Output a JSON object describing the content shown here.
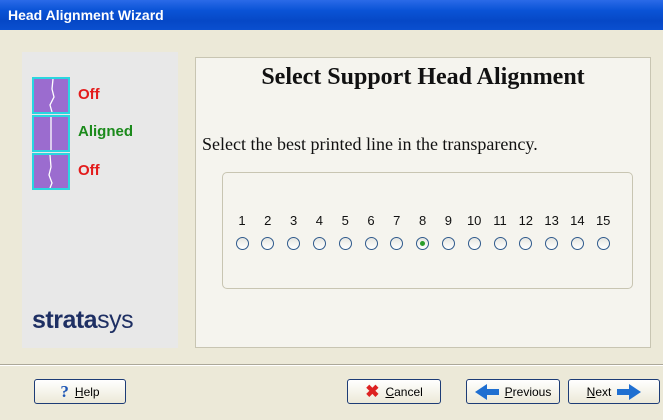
{
  "window": {
    "title": "Head Alignment Wizard"
  },
  "indicators": [
    {
      "label": "Off",
      "color": "#e31b1b",
      "status": "off"
    },
    {
      "label": "Aligned",
      "color": "#1b8a1b",
      "status": "aligned"
    },
    {
      "label": "Off",
      "color": "#e31b1b",
      "status": "off"
    }
  ],
  "logo": {
    "bold": "strata",
    "regular": "sys"
  },
  "main": {
    "heading": "Select Support Head Alignment",
    "instruction": "Select the best printed line in the transparency.",
    "options": [
      "1",
      "2",
      "3",
      "4",
      "5",
      "6",
      "7",
      "8",
      "9",
      "10",
      "11",
      "12",
      "13",
      "14",
      "15"
    ],
    "selected_option": "8"
  },
  "buttons": {
    "help": {
      "mnemonic": "H",
      "rest": "elp"
    },
    "cancel": {
      "mnemonic": "C",
      "rest": "ancel"
    },
    "previous": {
      "mnemonic": "P",
      "rest": "revious"
    },
    "next": {
      "mnemonic": "N",
      "rest": "ext"
    }
  },
  "icons": {
    "help": "question-mark-icon",
    "cancel": "x-icon",
    "previous": "left-arrow-icon",
    "next": "right-arrow-icon"
  }
}
